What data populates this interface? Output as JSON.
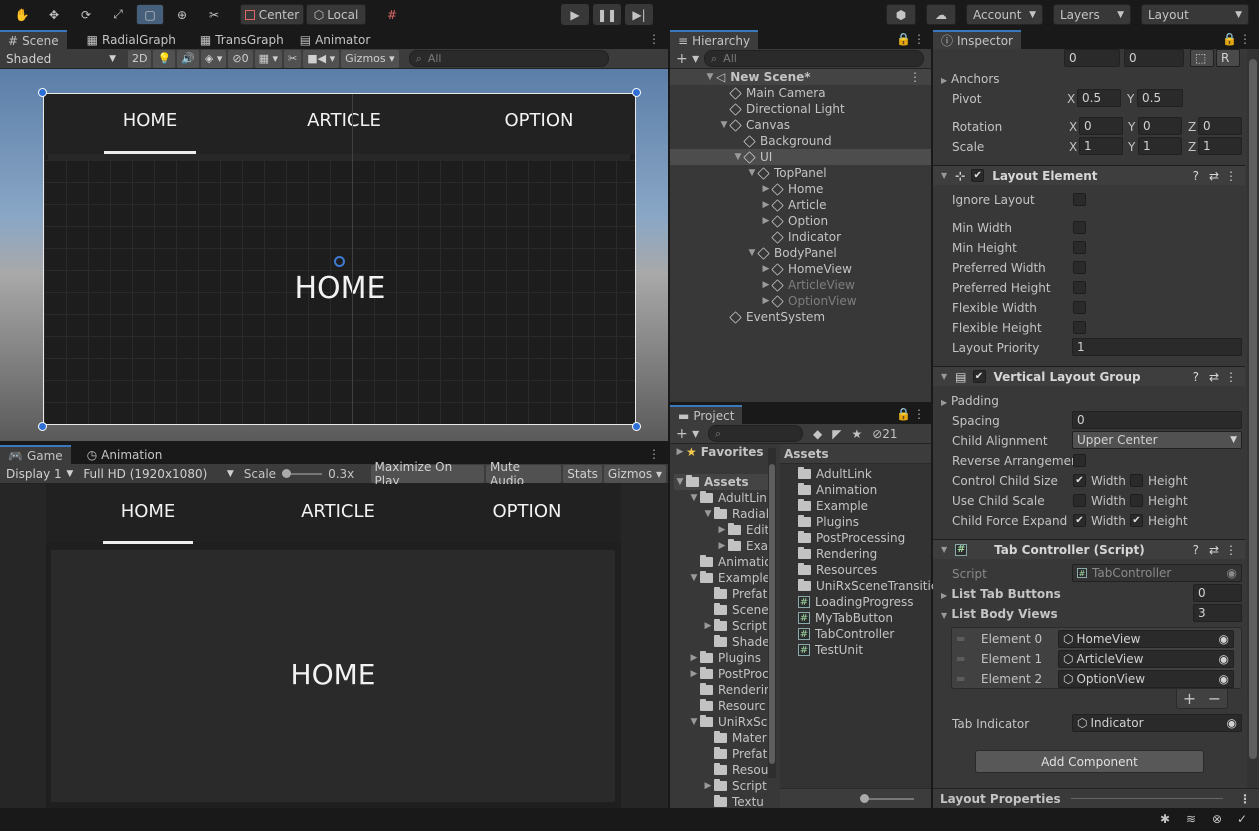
{
  "toolbar": {
    "pivot_label": "Center",
    "space_label": "Local",
    "account_label": "Account",
    "layers_label": "Layers",
    "layout_label": "Layout"
  },
  "scene": {
    "tabs": [
      {
        "label": "Scene",
        "icon": "grid-icon"
      },
      {
        "label": "RadialGraph",
        "icon": "graph-icon"
      },
      {
        "label": "TransGraph",
        "icon": "graph-icon"
      },
      {
        "label": "Animator",
        "icon": "animator-icon"
      }
    ],
    "shading": "Shaded",
    "mode_2d": "2D",
    "hidden_count": "0",
    "gizmos": "Gizmos",
    "search_placeholder": "All",
    "nav_tabs": [
      "HOME",
      "ARTICLE",
      "OPTION"
    ],
    "body_text": "HOME"
  },
  "game": {
    "tabs": [
      {
        "label": "Game",
        "icon": "gamepad-icon"
      },
      {
        "label": "Animation",
        "icon": "clock-icon"
      }
    ],
    "display": "Display 1",
    "resolution": "Full HD (1920x1080)",
    "scale_label": "Scale",
    "scale_value": "0.3x",
    "buttons": [
      "Maximize On Play",
      "Mute Audio",
      "Stats",
      "Gizmos"
    ],
    "nav_tabs": [
      "HOME",
      "ARTICLE",
      "OPTION"
    ],
    "body_text": "HOME"
  },
  "hierarchy": {
    "tab": "Hierarchy",
    "search_placeholder": "All",
    "rows": [
      {
        "label": "New Scene*",
        "depth": 0,
        "arrow": "▼",
        "icon": "unity",
        "bold": true,
        "selected": false,
        "dim": false
      },
      {
        "label": "Main Camera",
        "depth": 1,
        "arrow": "",
        "icon": "cube",
        "bold": false,
        "selected": false,
        "dim": false
      },
      {
        "label": "Directional Light",
        "depth": 1,
        "arrow": "",
        "icon": "cube",
        "bold": false,
        "selected": false,
        "dim": false
      },
      {
        "label": "Canvas",
        "depth": 1,
        "arrow": "▼",
        "icon": "cube",
        "bold": false,
        "selected": false,
        "dim": false
      },
      {
        "label": "Background",
        "depth": 2,
        "arrow": "",
        "icon": "cube",
        "bold": false,
        "selected": false,
        "dim": false
      },
      {
        "label": "UI",
        "depth": 2,
        "arrow": "▼",
        "icon": "cube",
        "bold": false,
        "selected": true,
        "dim": false
      },
      {
        "label": "TopPanel",
        "depth": 3,
        "arrow": "▼",
        "icon": "cube",
        "bold": false,
        "selected": false,
        "dim": false
      },
      {
        "label": "Home",
        "depth": 4,
        "arrow": "▶",
        "icon": "cube",
        "bold": false,
        "selected": false,
        "dim": false
      },
      {
        "label": "Article",
        "depth": 4,
        "arrow": "▶",
        "icon": "cube",
        "bold": false,
        "selected": false,
        "dim": false
      },
      {
        "label": "Option",
        "depth": 4,
        "arrow": "▶",
        "icon": "cube",
        "bold": false,
        "selected": false,
        "dim": false
      },
      {
        "label": "Indicator",
        "depth": 4,
        "arrow": "",
        "icon": "cube",
        "bold": false,
        "selected": false,
        "dim": false
      },
      {
        "label": "BodyPanel",
        "depth": 3,
        "arrow": "▼",
        "icon": "cube",
        "bold": false,
        "selected": false,
        "dim": false
      },
      {
        "label": "HomeView",
        "depth": 4,
        "arrow": "▶",
        "icon": "cube",
        "bold": false,
        "selected": false,
        "dim": false
      },
      {
        "label": "ArticleView",
        "depth": 4,
        "arrow": "▶",
        "icon": "cube",
        "bold": false,
        "selected": false,
        "dim": true
      },
      {
        "label": "OptionView",
        "depth": 4,
        "arrow": "▶",
        "icon": "cube",
        "bold": false,
        "selected": false,
        "dim": true
      },
      {
        "label": "EventSystem",
        "depth": 1,
        "arrow": "",
        "icon": "cube",
        "bold": false,
        "selected": false,
        "dim": false
      }
    ]
  },
  "project": {
    "tab": "Project",
    "hidden_count": "21",
    "favorites": "Favorites",
    "assets": "Assets",
    "tree": [
      {
        "label": "AdultLinl",
        "depth": 1,
        "arrow": "▼"
      },
      {
        "label": "Radial",
        "depth": 2,
        "arrow": "▼"
      },
      {
        "label": "Edit",
        "depth": 3,
        "arrow": "▶"
      },
      {
        "label": "Exa",
        "depth": 3,
        "arrow": "▶"
      },
      {
        "label": "Animatio",
        "depth": 1,
        "arrow": ""
      },
      {
        "label": "Example",
        "depth": 1,
        "arrow": "▼"
      },
      {
        "label": "Prefat",
        "depth": 2,
        "arrow": ""
      },
      {
        "label": "Scene",
        "depth": 2,
        "arrow": ""
      },
      {
        "label": "Script",
        "depth": 2,
        "arrow": "▶"
      },
      {
        "label": "Shade",
        "depth": 2,
        "arrow": ""
      },
      {
        "label": "Plugins",
        "depth": 1,
        "arrow": "▶"
      },
      {
        "label": "PostProc",
        "depth": 1,
        "arrow": "▶"
      },
      {
        "label": "Renderin",
        "depth": 1,
        "arrow": ""
      },
      {
        "label": "Resourc",
        "depth": 1,
        "arrow": ""
      },
      {
        "label": "UniRxSc",
        "depth": 1,
        "arrow": "▼"
      },
      {
        "label": "Mater",
        "depth": 2,
        "arrow": ""
      },
      {
        "label": "Prefat",
        "depth": 2,
        "arrow": ""
      },
      {
        "label": "Resou",
        "depth": 2,
        "arrow": ""
      },
      {
        "label": "Script",
        "depth": 2,
        "arrow": "▶"
      },
      {
        "label": "Textu",
        "depth": 2,
        "arrow": ""
      }
    ],
    "header": "Assets",
    "items": [
      {
        "label": "AdultLink",
        "type": "folder"
      },
      {
        "label": "Animation",
        "type": "folder"
      },
      {
        "label": "Example",
        "type": "folder"
      },
      {
        "label": "Plugins",
        "type": "folder"
      },
      {
        "label": "PostProcessing",
        "type": "folder"
      },
      {
        "label": "Rendering",
        "type": "folder"
      },
      {
        "label": "Resources",
        "type": "folder"
      },
      {
        "label": "UniRxSceneTransitic",
        "type": "folder"
      },
      {
        "label": "LoadingProgress",
        "type": "script"
      },
      {
        "label": "MyTabButton",
        "type": "script"
      },
      {
        "label": "TabController",
        "type": "script"
      },
      {
        "label": "TestUnit",
        "type": "script"
      }
    ]
  },
  "inspector": {
    "tab": "Inspector",
    "rect": {
      "top_values": [
        "0",
        "0"
      ],
      "anchors": "Anchors",
      "pivot": "Pivot",
      "pivot_x": "0.5",
      "pivot_y": "0.5",
      "rotation": "Rotation",
      "rot": [
        "0",
        "0",
        "0"
      ],
      "scale": "Scale",
      "scl": [
        "1",
        "1",
        "1"
      ],
      "x": "X",
      "y": "Y",
      "z": "Z",
      "r": "R"
    },
    "layout_element": {
      "title": "Layout Element",
      "rows": [
        "Ignore Layout",
        "Min Width",
        "Min Height",
        "Preferred Width",
        "Preferred Height",
        "Flexible Width",
        "Flexible Height",
        "Layout Priority"
      ],
      "priority": "1"
    },
    "vlg": {
      "title": "Vertical Layout Group",
      "padding": "Padding",
      "spacing": "Spacing",
      "spacing_value": "0",
      "child_alignment": "Child Alignment",
      "alignment_value": "Upper Center",
      "reverse": "Reverse Arrangement",
      "control_size": "Control Child Size",
      "use_scale": "Use Child Scale",
      "force_expand": "Child Force Expand",
      "width": "Width",
      "height": "Height"
    },
    "tab_controller": {
      "title": "Tab Controller (Script)",
      "script_label": "Script",
      "script_value": "TabController",
      "list_tab": "List Tab Buttons",
      "list_tab_count": "0",
      "list_body": "List Body Views",
      "list_body_count": "3",
      "elements": [
        {
          "label": "Element 0",
          "value": "HomeView"
        },
        {
          "label": "Element 1",
          "value": "ArticleView"
        },
        {
          "label": "Element 2",
          "value": "OptionView"
        }
      ],
      "indicator_label": "Tab Indicator",
      "indicator_value": "Indicator"
    },
    "add_component": "Add Component",
    "layout_properties": "Layout Properties"
  },
  "colors": {
    "accent": "#3a79bb",
    "selected_row": "#4d4d4d",
    "panel": "#383838",
    "dark": "#191919"
  }
}
